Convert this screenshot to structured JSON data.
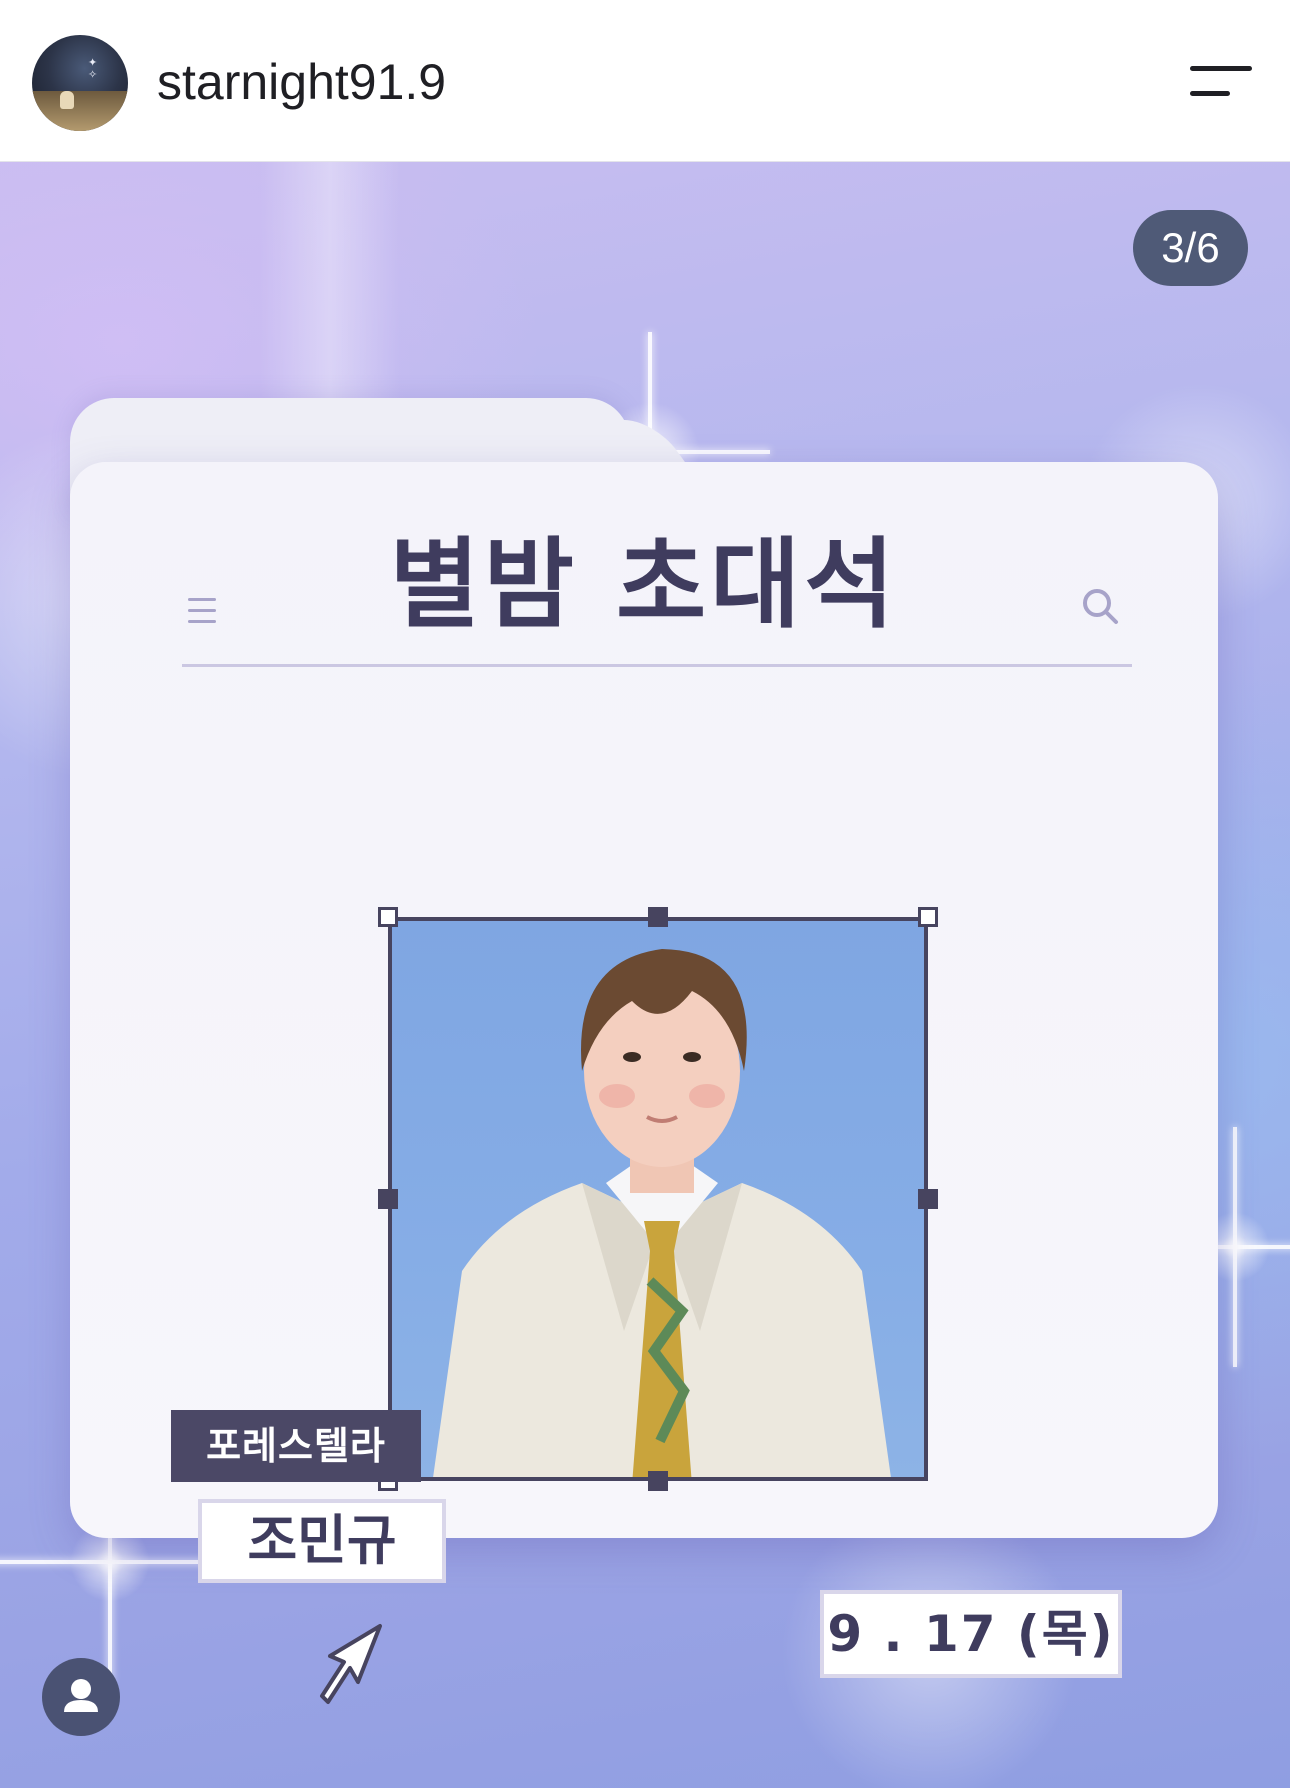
{
  "header": {
    "username": "starnight91.9",
    "avatar_icon": "profile-avatar",
    "menu_icon": "menu-icon"
  },
  "post": {
    "counter": "3/6",
    "card": {
      "title": "별밤 초대석",
      "menu_icon": "hamburger-icon",
      "search_icon": "search-icon"
    },
    "guest": {
      "group": "포레스텔라",
      "name": "조민규",
      "date": "9 . 17 (목)"
    },
    "account_icon": "person-icon",
    "colors": {
      "card_text": "#3f3c5e",
      "label_bg": "#4b4866",
      "counter_bg": "#4f5a77",
      "background_top": "#c8bdf0",
      "background_bottom": "#8f9ee2"
    }
  }
}
